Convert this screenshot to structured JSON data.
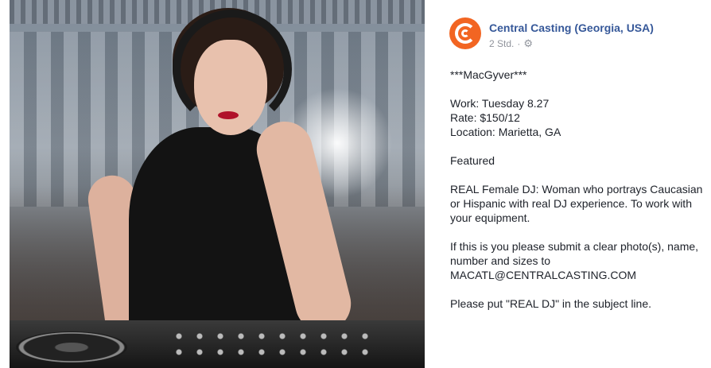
{
  "post": {
    "page_name": "Central Casting (Georgia, USA)",
    "timestamp": "2 Std.",
    "separator": "·",
    "privacy_icon": "gear-icon",
    "accent_color": "#f26522",
    "link_color": "#365899",
    "title": "***MacGyver***",
    "work": "Work: Tuesday 8.27",
    "rate": "Rate: $150/12",
    "location": "Location: Marietta, GA",
    "featured": "Featured",
    "role": "REAL Female DJ: Woman who portrays Caucasian or Hispanic with real DJ experience. To work with your equipment.",
    "instructions": "If this is you please submit a clear photo(s), name, number and sizes to MACATL@CENTRALCASTING.COM",
    "subject": "Please put \"REAL DJ\" in the subject line."
  },
  "photo": {
    "subject_icon": "dj-photo"
  }
}
